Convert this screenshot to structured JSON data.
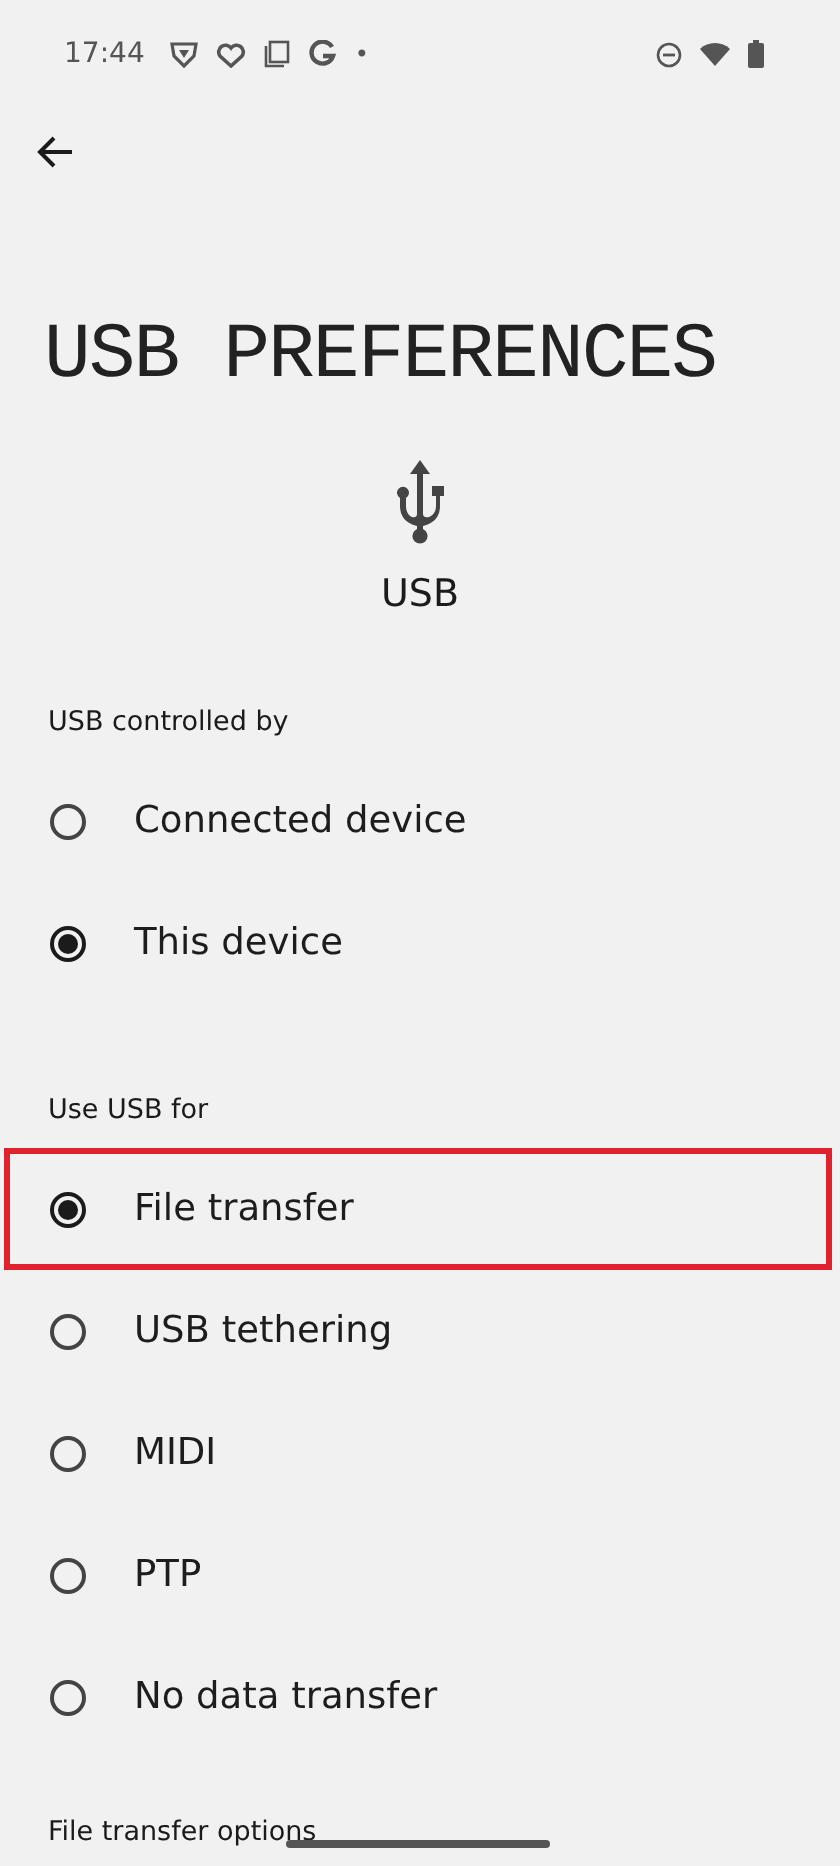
{
  "status_bar": {
    "time": "17:44",
    "dot": "•"
  },
  "title": "USB PREFERENCES",
  "header": {
    "label": "USB"
  },
  "sections": [
    {
      "title": "USB controlled by",
      "options": [
        {
          "label": "Connected device",
          "selected": false,
          "highlighted": false
        },
        {
          "label": "This device",
          "selected": true,
          "highlighted": false
        }
      ]
    },
    {
      "title": "Use USB for",
      "options": [
        {
          "label": "File transfer",
          "selected": true,
          "highlighted": true
        },
        {
          "label": "USB tethering",
          "selected": false,
          "highlighted": false
        },
        {
          "label": "MIDI",
          "selected": false,
          "highlighted": false
        },
        {
          "label": "PTP",
          "selected": false,
          "highlighted": false
        },
        {
          "label": "No data transfer",
          "selected": false,
          "highlighted": false
        }
      ]
    },
    {
      "title": "File transfer options"
    }
  ]
}
